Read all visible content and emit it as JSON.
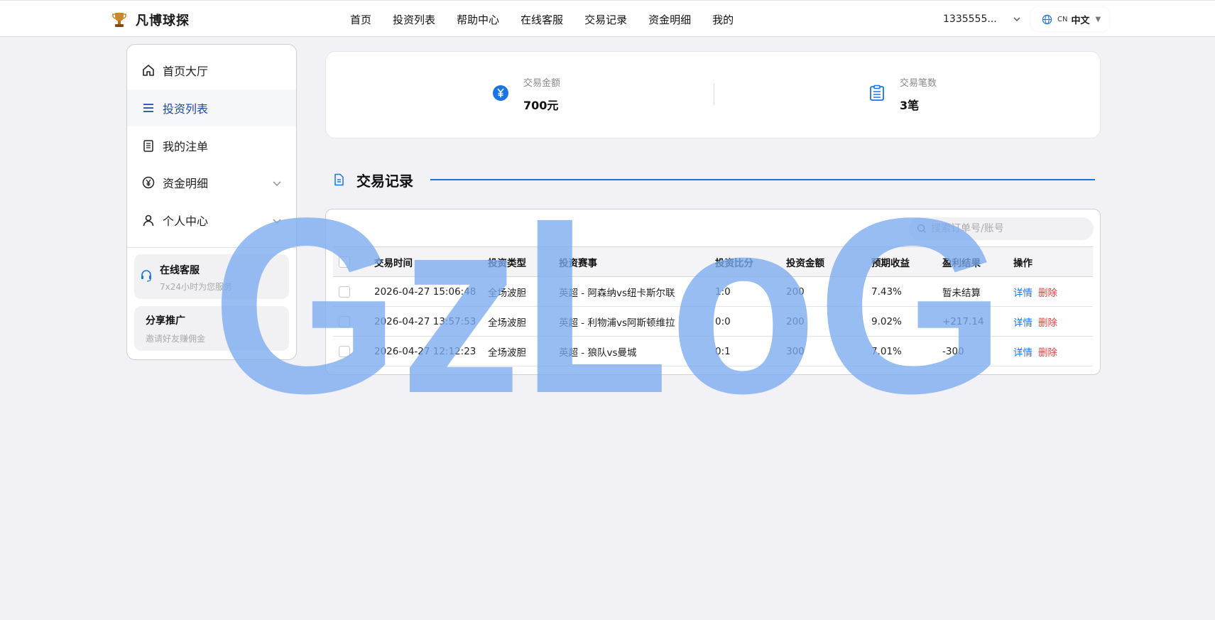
{
  "header": {
    "brand": "凡博球探",
    "nav": [
      "首页",
      "投资列表",
      "帮助中心",
      "在线客服",
      "交易记录",
      "资金明细",
      "我的"
    ],
    "user": "1335555...",
    "lang_code": "CN",
    "lang_label": "中文",
    "lang_caret": "▼"
  },
  "sidebar": {
    "items": [
      {
        "label": "首页大厅",
        "icon": "home-icon"
      },
      {
        "label": "投资列表",
        "icon": "list-icon"
      },
      {
        "label": "我的注单",
        "icon": "document-icon"
      },
      {
        "label": "资金明细",
        "icon": "yen-circle-icon"
      },
      {
        "label": "个人中心",
        "icon": "user-icon"
      }
    ],
    "support": {
      "title": "在线客服",
      "subtitle": "7x24小时为您服务"
    },
    "share": {
      "title": "分享推广",
      "subtitle": "邀请好友赚佣金"
    }
  },
  "stats": {
    "amount_label": "交易金额",
    "amount_value": "700元",
    "count_label": "交易笔数",
    "count_value": "3笔"
  },
  "section": {
    "title": "交易记录"
  },
  "search": {
    "placeholder": "搜索订单号/账号"
  },
  "table": {
    "headers": [
      "交易时间",
      "投资类型",
      "投资赛事",
      "投资比分",
      "投资金额",
      "预期收益",
      "盈利结果",
      "操作"
    ],
    "rows": [
      {
        "time": "2026-04-27 15:06:48",
        "type": "全场波胆",
        "match": "英超 - 阿森纳vs纽卡斯尔联",
        "score": "1:0",
        "amount": "200",
        "expected": "7.43%",
        "result": "暂未结算",
        "detail": "详情",
        "delete": "删除"
      },
      {
        "time": "2026-04-27 13:57:53",
        "type": "全场波胆",
        "match": "英超 - 利物浦vs阿斯顿维拉",
        "score": "0:0",
        "amount": "200",
        "expected": "9.02%",
        "result": "+217.14",
        "detail": "详情",
        "delete": "删除"
      },
      {
        "time": "2026-04-27 12:12:23",
        "type": "全场波胆",
        "match": "英超 - 狼队vs曼城",
        "score": "0:1",
        "amount": "300",
        "expected": "7.01%",
        "result": "-300",
        "detail": "详情",
        "delete": "删除"
      }
    ]
  },
  "watermark": {
    "text": "GzLoG",
    "color": "#7aaaf0"
  },
  "colors": {
    "accent": "#1b73e8",
    "danger": "#e94040",
    "active_text": "#1a4aa8"
  }
}
